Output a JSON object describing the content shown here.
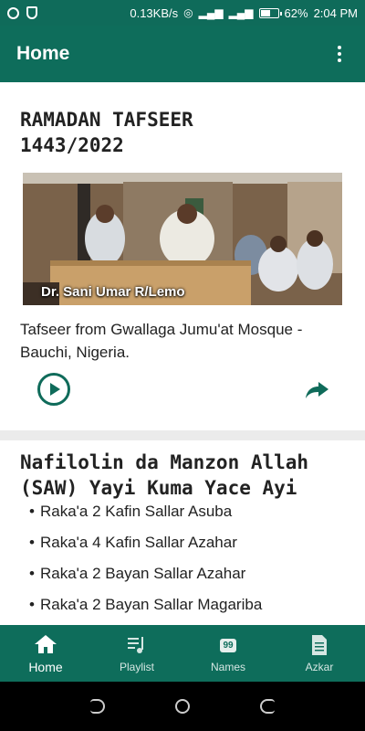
{
  "status_bar": {
    "speed": "0.13KB/s",
    "battery": "62%",
    "battery_level": 0.62,
    "time": "2:04 PM"
  },
  "app_bar": {
    "title": "Home",
    "menu_icon": "overflow-menu-icon"
  },
  "cards": [
    {
      "title": "RAMADAN TAFSEER 1443/2022",
      "image_caption": "Dr. Sani Umar R/Lemo",
      "description": "Tafseer from Gwallaga Jumu'at Mosque - Bauchi, Nigeria.",
      "play_icon": "play-circle-icon",
      "share_icon": "share-arrow-icon"
    },
    {
      "title": "Nafilolin da Manzon Allah (SAW) Yayi Kuma Yace Ayi",
      "bullet": "•",
      "items": [
        "Raka'a 2 Kafin Sallar Asuba",
        "Raka'a 4 Kafin Sallar Azahar",
        "Raka'a 2 Bayan Sallar Azahar",
        "Raka'a 2 Bayan Sallar Magariba"
      ]
    }
  ],
  "bottom_nav": [
    {
      "label": "Home",
      "icon": "home-icon",
      "active": true
    },
    {
      "label": "Playlist",
      "icon": "playlist-icon",
      "active": false
    },
    {
      "label": "Names",
      "icon": "names-99-icon",
      "badge": "99",
      "active": false
    },
    {
      "label": "Azkar",
      "icon": "document-icon",
      "active": false
    }
  ],
  "colors": {
    "primary": "#0e6d5b",
    "background": "#ebebeb",
    "text": "#222222"
  }
}
